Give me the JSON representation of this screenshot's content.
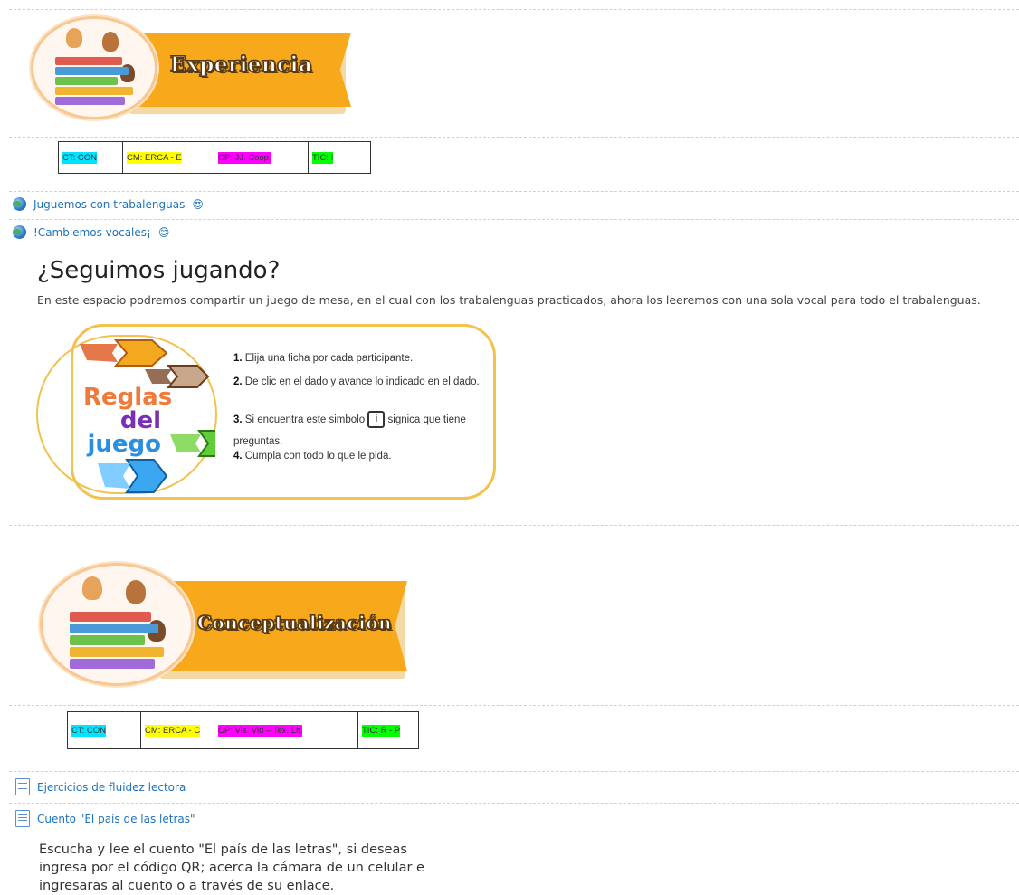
{
  "banner1": {
    "title": "Experiencia"
  },
  "table1": {
    "cells": [
      {
        "label": "CT: CON",
        "color": "#00e5ff"
      },
      {
        "label": "CM: ERCA - E",
        "color": "#ffff00"
      },
      {
        "label": "CP: JJ. Coop.",
        "color": "#ff00ff"
      },
      {
        "label": "TIC: I",
        "color": "#00ff00"
      }
    ]
  },
  "activities1": [
    {
      "label": "Juguemos con trabalenguas",
      "icon": "globe-icon",
      "emoji": "😍"
    },
    {
      "label": "!Cambiemos vocales¡",
      "icon": "globe-icon",
      "emoji": "😊"
    }
  ],
  "section": {
    "title": "¿Seguimos jugando?",
    "text": "En este espacio podremos compartir un juego de mesa, en el cual con los trabalenguas practicados, ahora los leeremos con una sola vocal para todo el trabalenguas."
  },
  "rules": {
    "title1": "Reglas",
    "title2": "del",
    "title3": "juego",
    "items": [
      {
        "num": "1.",
        "text": "Elija una ficha por cada participante."
      },
      {
        "num": "2.",
        "text": "De clic en el dado y avance lo indicado en el dado."
      },
      {
        "num": "3.",
        "text_a": "Si encuentra este simbolo",
        "icon": "i",
        "text_b": "signica que tiene preguntas."
      },
      {
        "num": "4.",
        "text": "Cumpla con todo lo que le pida."
      }
    ]
  },
  "banner2": {
    "title": "Conceptualización"
  },
  "table2": {
    "cells": [
      {
        "label": "CT: CON",
        "color": "#00e5ff"
      },
      {
        "label": "CM: ERCA - C",
        "color": "#ffff00"
      },
      {
        "label": "CP: Vis. Vid – Tex. Lit.",
        "color": "#ff00ff"
      },
      {
        "label": "TIC: R - P",
        "color": "#00ff00"
      }
    ]
  },
  "activities2": [
    {
      "label": "Ejercicios de fluidez lectora",
      "icon": "page-icon"
    },
    {
      "label": "Cuento \"El país de las letras\"",
      "icon": "page-icon"
    }
  ],
  "story": {
    "text": "Escucha y lee el cuento \"El país de las letras\", si deseas ingresa por el código QR; acerca la cámara de un celular e ingresaras al cuento o a través de su enlace."
  }
}
